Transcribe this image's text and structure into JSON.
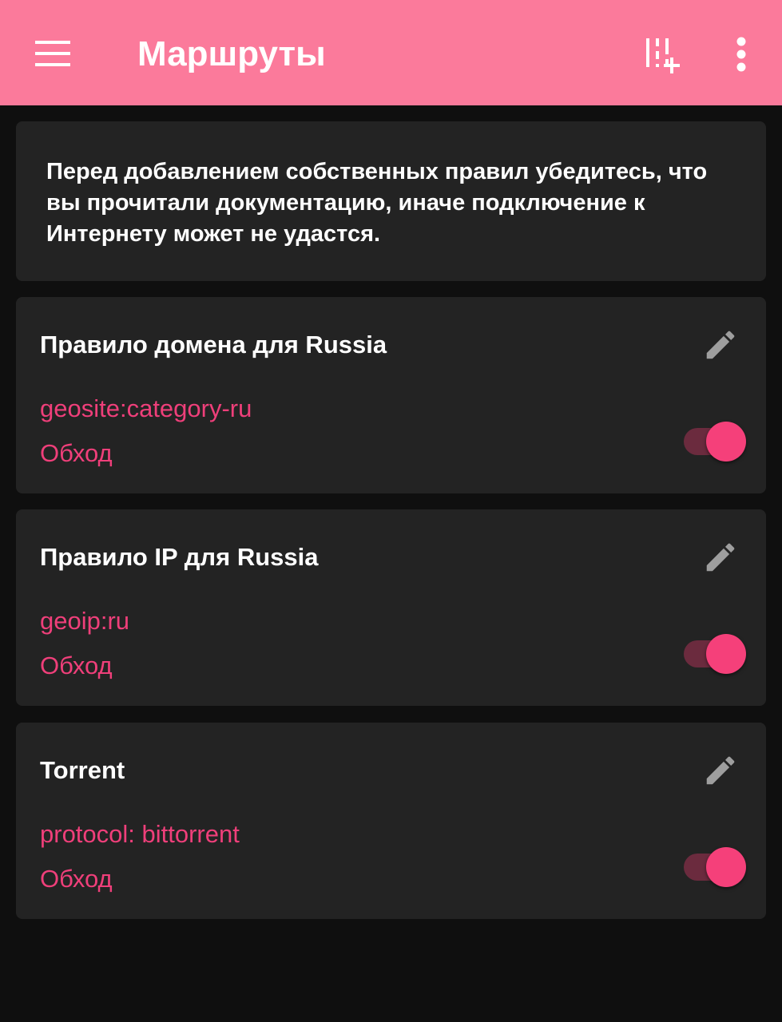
{
  "toolbar": {
    "title": "Маршруты",
    "menu_icon": "menu-icon",
    "add_icon": "add-rule-icon",
    "more_icon": "more-vert-icon",
    "background": "#fb7a9b"
  },
  "info": {
    "text": "Перед добавлением собственных правил убедитесь, что вы прочитали документацию, иначе подключение к Интернету может не удастся."
  },
  "rules": [
    {
      "title": "Правило домена для Russia",
      "pattern": "geosite:category-ru",
      "action": "Обход",
      "enabled": true
    },
    {
      "title": "Правило IP для Russia",
      "pattern": "geoip:ru",
      "action": "Обход",
      "enabled": true
    },
    {
      "title": "Torrent",
      "pattern": "protocol: bittorrent",
      "action": "Обход",
      "enabled": true
    }
  ],
  "colors": {
    "accent": "#f5407a",
    "accent_text": "#ef3f7a",
    "card": "#232323",
    "background": "#0f0f0f"
  }
}
